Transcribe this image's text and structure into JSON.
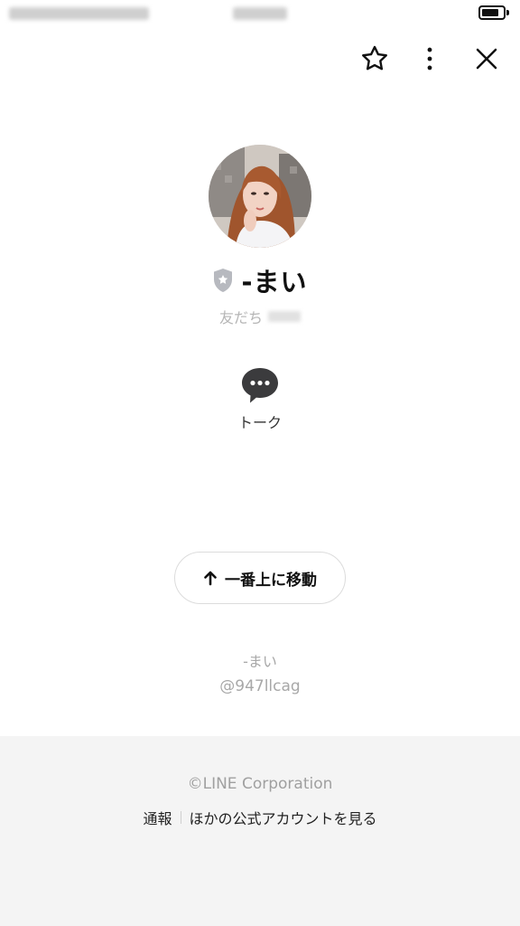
{
  "header": {
    "icons": {
      "favorite": "star-outline-icon",
      "more": "more-vertical-icon",
      "close": "close-icon"
    }
  },
  "status_bar": {
    "battery_level": 0.8
  },
  "profile": {
    "name": "-まい",
    "badge_icon": "official-shield-icon",
    "subtitle": "友だち",
    "talk_label": "トーク"
  },
  "scroll_top": {
    "label": "一番上に移動",
    "icon": "arrow-up-icon"
  },
  "account_footer": {
    "name": "-まい",
    "line_id": "@947llcag"
  },
  "site_footer": {
    "copyright": "©LINE Corporation",
    "report_link": "通報",
    "other_accounts_link": "ほかの公式アカウントを見る"
  }
}
